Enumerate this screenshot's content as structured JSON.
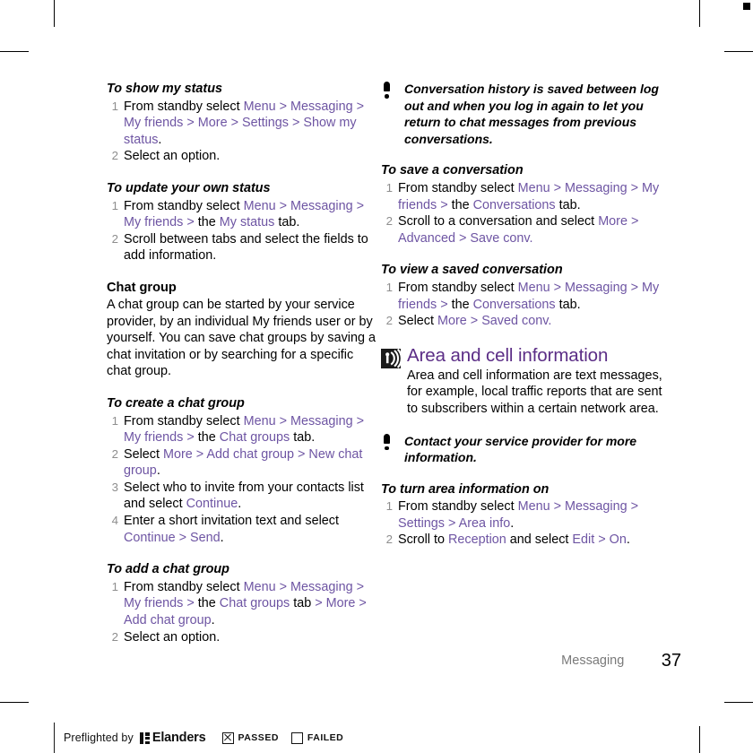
{
  "document": {
    "footer": {
      "section_label": "Messaging",
      "page_number": "37"
    },
    "preflight": {
      "label": "Preflighted by",
      "brand": "Elanders",
      "passed_label": "PASSED",
      "failed_label": "FAILED",
      "passed_checked": true,
      "failed_checked": false
    },
    "colors": {
      "ui_term": "#6E55A3",
      "section_heading": "#5B2D86",
      "body_text": "#000000",
      "step_number": "#8E8E8E",
      "footer_label": "#7A7A7A"
    }
  },
  "left_column": {
    "blocks": [
      {
        "heading": "To show my status",
        "steps": [
          {
            "num": "1",
            "parts": [
              {
                "t": "From standby select ",
                "s": "plain"
              },
              {
                "t": "Menu",
                "s": "ui"
              },
              {
                "t": " > ",
                "s": "gt"
              },
              {
                "t": "Messaging",
                "s": "ui"
              },
              {
                "t": " > ",
                "s": "gt"
              },
              {
                "t": "My friends",
                "s": "ui"
              },
              {
                "t": " > ",
                "s": "gt"
              },
              {
                "t": "More",
                "s": "ui"
              },
              {
                "t": " > ",
                "s": "gt"
              },
              {
                "t": "Settings",
                "s": "ui"
              },
              {
                "t": " > ",
                "s": "gt"
              },
              {
                "t": "Show my status",
                "s": "ui"
              },
              {
                "t": ".",
                "s": "plain"
              }
            ]
          },
          {
            "num": "2",
            "parts": [
              {
                "t": "Select an option.",
                "s": "plain"
              }
            ]
          }
        ]
      },
      {
        "heading": "To update your own status",
        "steps": [
          {
            "num": "1",
            "parts": [
              {
                "t": "From standby select ",
                "s": "plain"
              },
              {
                "t": "Menu",
                "s": "ui"
              },
              {
                "t": " > ",
                "s": "gt"
              },
              {
                "t": "Messaging",
                "s": "ui"
              },
              {
                "t": " > ",
                "s": "gt"
              },
              {
                "t": "My friends",
                "s": "ui"
              },
              {
                "t": " > ",
                "s": "gt"
              },
              {
                "t": "the ",
                "s": "plain"
              },
              {
                "t": "My status",
                "s": "ui"
              },
              {
                "t": " tab.",
                "s": "plain"
              }
            ]
          },
          {
            "num": "2",
            "parts": [
              {
                "t": "Scroll between tabs and select the fields to add information.",
                "s": "plain"
              }
            ]
          }
        ]
      },
      {
        "plain_heading": "Chat group",
        "paragraph": "A chat group can be started by your service provider, by an individual My friends user or by yourself. You can save chat groups by saving a chat invitation or by searching for a specific chat group."
      },
      {
        "heading": "To create a chat group",
        "steps": [
          {
            "num": "1",
            "parts": [
              {
                "t": "From standby select ",
                "s": "plain"
              },
              {
                "t": "Menu",
                "s": "ui"
              },
              {
                "t": " > ",
                "s": "gt"
              },
              {
                "t": "Messaging",
                "s": "ui"
              },
              {
                "t": " > ",
                "s": "gt"
              },
              {
                "t": "My friends",
                "s": "ui"
              },
              {
                "t": " > ",
                "s": "gt"
              },
              {
                "t": "the ",
                "s": "plain"
              },
              {
                "t": "Chat groups",
                "s": "ui"
              },
              {
                "t": " tab.",
                "s": "plain"
              }
            ]
          },
          {
            "num": "2",
            "parts": [
              {
                "t": "Select ",
                "s": "plain"
              },
              {
                "t": "More",
                "s": "ui"
              },
              {
                "t": " > ",
                "s": "gt"
              },
              {
                "t": "Add chat group",
                "s": "ui"
              },
              {
                "t": " > ",
                "s": "gt"
              },
              {
                "t": "New chat group",
                "s": "ui"
              },
              {
                "t": ".",
                "s": "plain"
              }
            ]
          },
          {
            "num": "3",
            "parts": [
              {
                "t": "Select who to invite from your contacts list and select ",
                "s": "plain"
              },
              {
                "t": "Continue",
                "s": "ui"
              },
              {
                "t": ".",
                "s": "plain"
              }
            ]
          },
          {
            "num": "4",
            "parts": [
              {
                "t": "Enter a short invitation text and select ",
                "s": "plain"
              },
              {
                "t": "Continue",
                "s": "ui"
              },
              {
                "t": " > ",
                "s": "gt"
              },
              {
                "t": "Send",
                "s": "ui"
              },
              {
                "t": ".",
                "s": "plain"
              }
            ]
          }
        ]
      },
      {
        "heading": "To add a chat group",
        "steps": [
          {
            "num": "1",
            "parts": [
              {
                "t": "From standby select ",
                "s": "plain"
              },
              {
                "t": "Menu",
                "s": "ui"
              },
              {
                "t": " > ",
                "s": "gt"
              },
              {
                "t": "Messaging",
                "s": "ui"
              },
              {
                "t": " > ",
                "s": "gt"
              },
              {
                "t": "My friends",
                "s": "ui"
              },
              {
                "t": " > ",
                "s": "gt"
              },
              {
                "t": "the ",
                "s": "plain"
              },
              {
                "t": "Chat groups",
                "s": "ui"
              },
              {
                "t": " tab",
                "s": "plain"
              },
              {
                "t": " > ",
                "s": "gt"
              },
              {
                "t": "More",
                "s": "ui"
              },
              {
                "t": " > ",
                "s": "gt"
              },
              {
                "t": "Add chat group",
                "s": "ui"
              },
              {
                "t": ".",
                "s": "plain"
              }
            ]
          },
          {
            "num": "2",
            "parts": [
              {
                "t": "Select an option.",
                "s": "plain"
              }
            ]
          }
        ]
      }
    ]
  },
  "right_column": {
    "note_1": "Conversation history is saved between log out and when you log in again to let you return to chat messages from previous conversations.",
    "blocks": [
      {
        "heading": "To save a conversation",
        "steps": [
          {
            "num": "1",
            "parts": [
              {
                "t": "From standby select ",
                "s": "plain"
              },
              {
                "t": "Menu",
                "s": "ui"
              },
              {
                "t": " > ",
                "s": "gt"
              },
              {
                "t": "Messaging",
                "s": "ui"
              },
              {
                "t": " > ",
                "s": "gt"
              },
              {
                "t": "My friends",
                "s": "ui"
              },
              {
                "t": " > ",
                "s": "gt"
              },
              {
                "t": "the ",
                "s": "plain"
              },
              {
                "t": "Conversations",
                "s": "ui"
              },
              {
                "t": " tab.",
                "s": "plain"
              }
            ]
          },
          {
            "num": "2",
            "parts": [
              {
                "t": "Scroll to a conversation and select ",
                "s": "plain"
              },
              {
                "t": "More",
                "s": "ui"
              },
              {
                "t": " > ",
                "s": "gt"
              },
              {
                "t": "Advanced",
                "s": "ui"
              },
              {
                "t": " > ",
                "s": "gt"
              },
              {
                "t": "Save conv.",
                "s": "ui"
              }
            ]
          }
        ]
      },
      {
        "heading": "To view a saved conversation",
        "steps": [
          {
            "num": "1",
            "parts": [
              {
                "t": "From standby select ",
                "s": "plain"
              },
              {
                "t": "Menu",
                "s": "ui"
              },
              {
                "t": " > ",
                "s": "gt"
              },
              {
                "t": "Messaging",
                "s": "ui"
              },
              {
                "t": " > ",
                "s": "gt"
              },
              {
                "t": "My friends",
                "s": "ui"
              },
              {
                "t": " > ",
                "s": "gt"
              },
              {
                "t": "the ",
                "s": "plain"
              },
              {
                "t": "Conversations",
                "s": "ui"
              },
              {
                "t": " tab.",
                "s": "plain"
              }
            ]
          },
          {
            "num": "2",
            "parts": [
              {
                "t": "Select ",
                "s": "plain"
              },
              {
                "t": "More",
                "s": "ui"
              },
              {
                "t": " > ",
                "s": "gt"
              },
              {
                "t": "Saved conv.",
                "s": "ui"
              }
            ]
          }
        ]
      }
    ],
    "section": {
      "icon": "broadcast-antenna-icon",
      "title": "Area and cell information",
      "body": "Area and cell information are text messages, for example, local traffic reports that are sent to subscribers within a certain network area."
    },
    "note_2": "Contact your service provider for more information.",
    "blocks_after": [
      {
        "heading": "To turn area information on",
        "steps": [
          {
            "num": "1",
            "parts": [
              {
                "t": "From standby select ",
                "s": "plain"
              },
              {
                "t": "Menu",
                "s": "ui"
              },
              {
                "t": " > ",
                "s": "gt"
              },
              {
                "t": "Messaging",
                "s": "ui"
              },
              {
                "t": " > ",
                "s": "gt"
              },
              {
                "t": "Settings",
                "s": "ui"
              },
              {
                "t": " > ",
                "s": "gt"
              },
              {
                "t": "Area info",
                "s": "ui"
              },
              {
                "t": ".",
                "s": "plain"
              }
            ]
          },
          {
            "num": "2",
            "parts": [
              {
                "t": "Scroll to ",
                "s": "plain"
              },
              {
                "t": "Reception",
                "s": "ui"
              },
              {
                "t": " and select ",
                "s": "plain"
              },
              {
                "t": "Edit",
                "s": "ui"
              },
              {
                "t": " > ",
                "s": "gt"
              },
              {
                "t": "On",
                "s": "ui"
              },
              {
                "t": ".",
                "s": "plain"
              }
            ]
          }
        ]
      }
    ]
  }
}
